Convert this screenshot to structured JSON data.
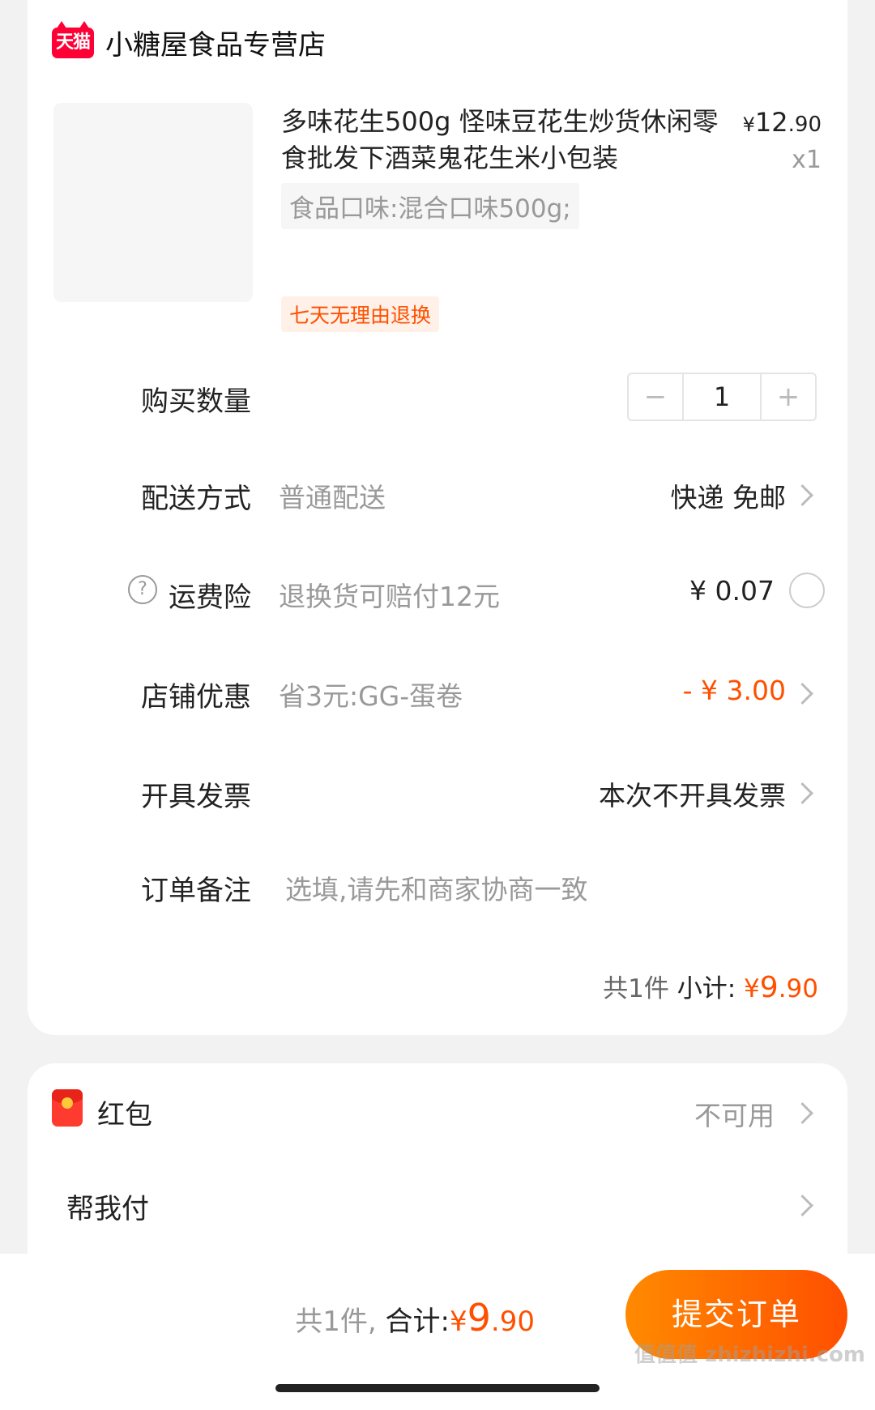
{
  "shop": {
    "badge": "天猫",
    "name": "小糖屋食品专营店"
  },
  "product": {
    "title": "多味花生500g 怪味豆花生炒货休闲零食批发下酒菜鬼花生米小包装",
    "price_symbol": "¥",
    "price_int": "12",
    "price_dec": ".90",
    "quantity": "x1",
    "spec": "食品口味:混合口味500g;",
    "return_tag": "七天无理由退换"
  },
  "rows": {
    "quantity": {
      "label": "购买数量",
      "minus": "−",
      "value": "1",
      "plus": "+"
    },
    "delivery": {
      "label": "配送方式",
      "sub": "普通配送",
      "value": "快递 免邮"
    },
    "insurance": {
      "icon": "?",
      "label": "运费险",
      "sub": "退换货可赔付12元",
      "value": "¥ 0.07"
    },
    "discount": {
      "label": "店铺优惠",
      "sub": "省3元:GG-蛋卷",
      "value": "- ¥ 3.00"
    },
    "invoice": {
      "label": "开具发票",
      "value": "本次不开具发票"
    },
    "note": {
      "label": "订单备注",
      "placeholder": "选填,请先和商家协商一致"
    }
  },
  "subtotal": {
    "count": "共1件",
    "label": "小计: ",
    "symbol": "¥",
    "int": "9",
    "dec": ".90"
  },
  "extra": {
    "redpacket": {
      "label": "红包",
      "value": "不可用"
    },
    "helppay": {
      "label": "帮我付"
    }
  },
  "footer": {
    "count": "共1件,",
    "label": "合计:",
    "symbol": "¥",
    "int": "9",
    "dec": ".90",
    "submit": "提交订单",
    "watermark": "值值值 zhizhizhi.com"
  },
  "colors": {
    "accent": "#ff5000",
    "tmall": "#ff0036",
    "background": "#f2f2f2"
  }
}
